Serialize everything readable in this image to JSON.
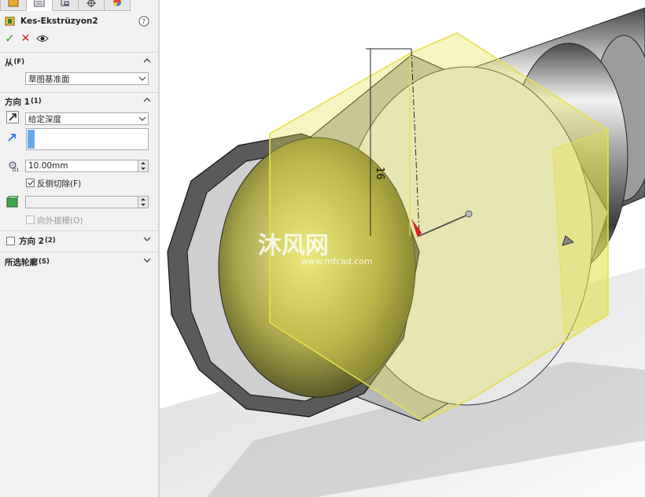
{
  "feature": {
    "title": "Kes-Ekstrüzyon2",
    "tabs": [
      "feature-manager",
      "property-manager",
      "configuration-manager",
      "dimxpert-manager",
      "display-manager"
    ],
    "actions": {
      "ok": "✓",
      "cancel": "✕",
      "preview": "preview-eye"
    }
  },
  "from_section": {
    "label": "从",
    "shortcut": "(F)",
    "value": "草图基准面"
  },
  "direction1": {
    "label": "方向 1",
    "shortcut": "(1)",
    "end_condition": "给定深度",
    "depth": "10.00mm",
    "flip_side_label": "反侧切除(F)",
    "flip_side_checked": true,
    "draft_label": "向外拔模(O)",
    "draft_checked": false
  },
  "direction2": {
    "label": "方向 2",
    "shortcut": "(2)",
    "checked": false
  },
  "selected_contours": {
    "label": "所选轮廓",
    "shortcut": "(S)"
  },
  "viewport": {
    "dimension_text": "16",
    "watermark": "沐风网",
    "watermark_url": "www.mfcad.com"
  },
  "colors": {
    "accent": "#6aa8ea",
    "ok": "#2e9d2e",
    "cancel": "#d62020",
    "preview_yellow": "#e6e04a"
  }
}
